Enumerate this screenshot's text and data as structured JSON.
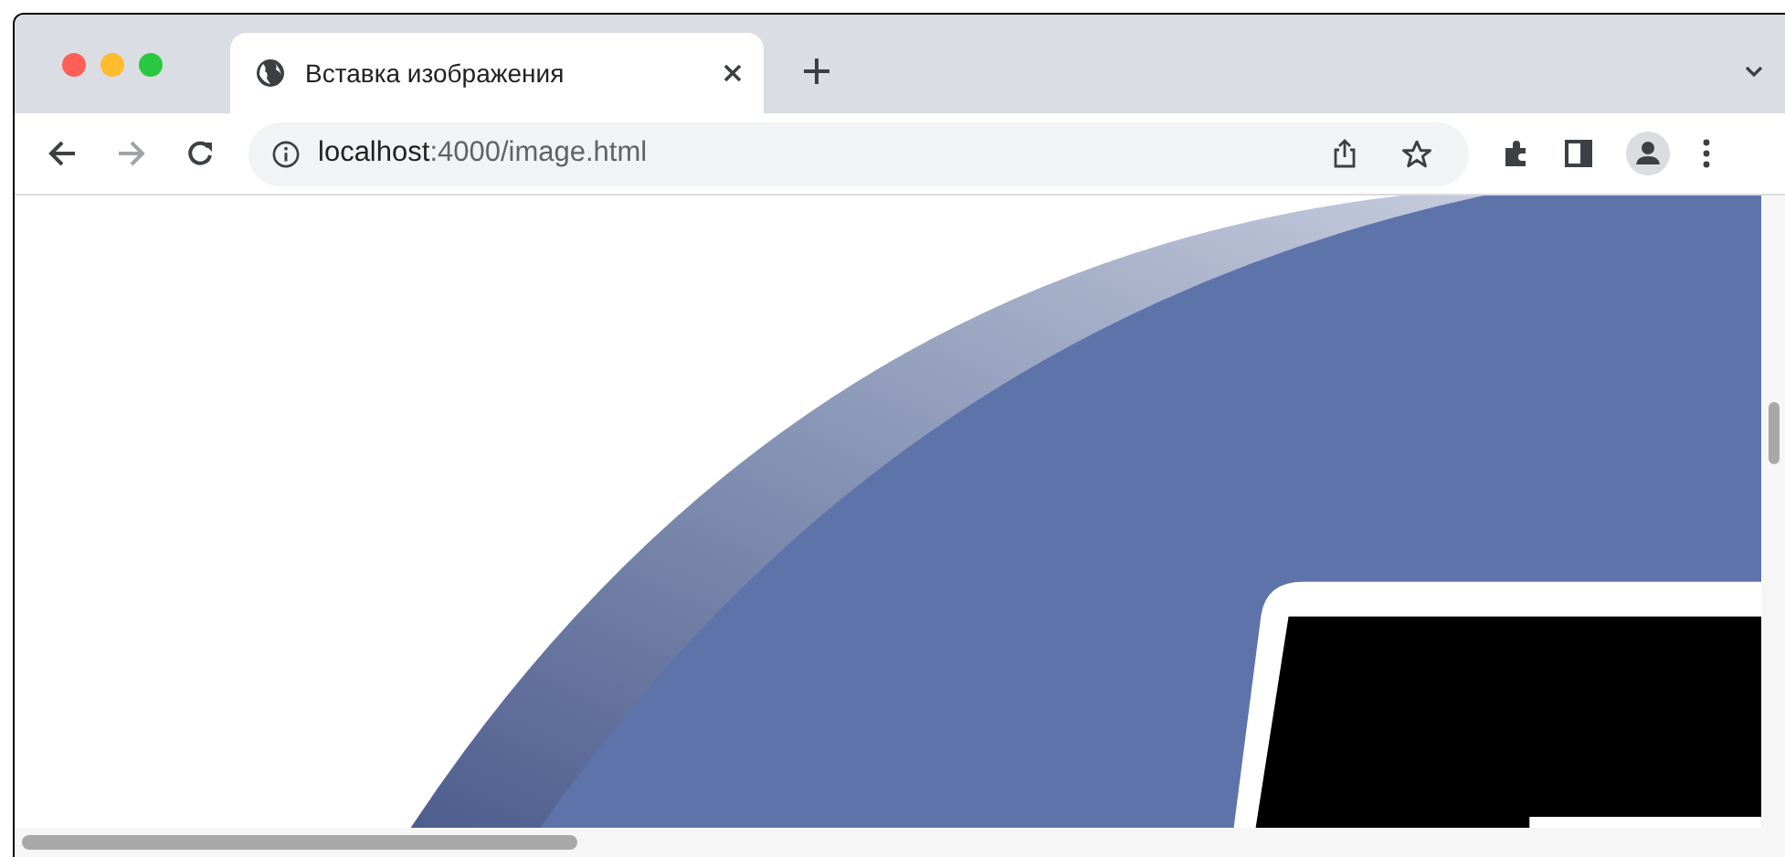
{
  "tab": {
    "title": "Вставка изображения",
    "selected": true
  },
  "address_bar": {
    "host": "localhost",
    "path": ":4000/image.html"
  }
}
